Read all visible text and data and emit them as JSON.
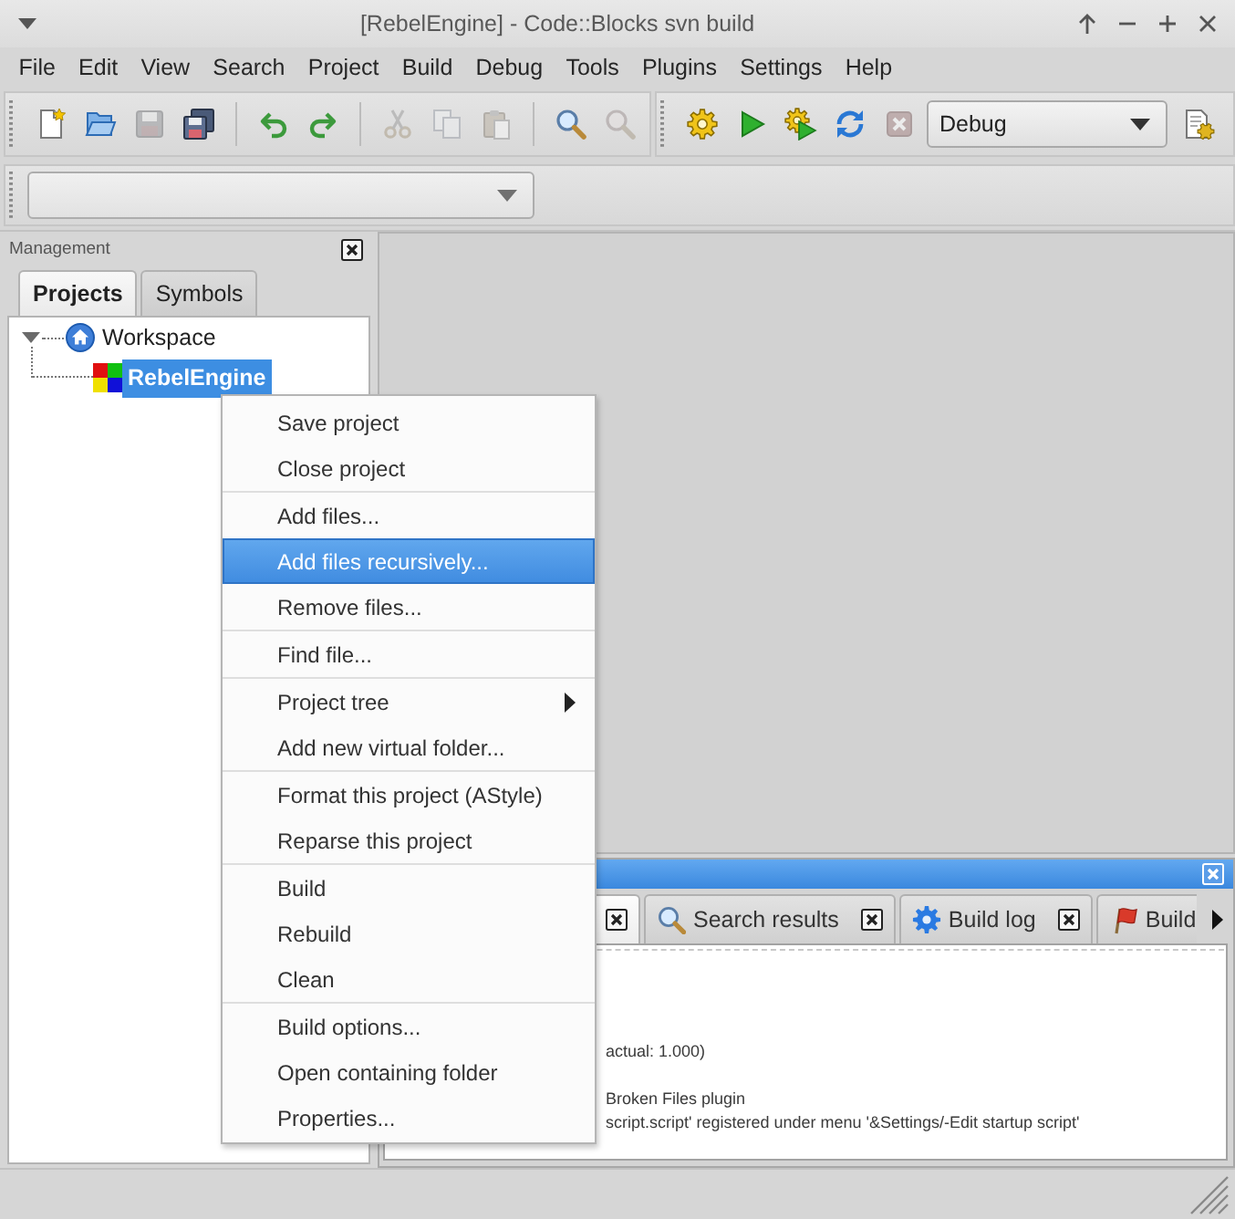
{
  "window": {
    "title": "[RebelEngine] - Code::Blocks svn build"
  },
  "menu_bar": [
    "File",
    "Edit",
    "View",
    "Search",
    "Project",
    "Build",
    "Debug",
    "Tools",
    "Plugins",
    "Settings",
    "Help"
  ],
  "main_toolbar": {
    "buttons": [
      {
        "disabled": false
      },
      {
        "disabled": false
      },
      {
        "disabled": true
      },
      {
        "disabled": false
      },
      {
        "disabled": false
      },
      {
        "disabled": false
      },
      {
        "disabled": true
      },
      {
        "disabled": true
      },
      {
        "disabled": true
      },
      {
        "disabled": false
      },
      {
        "disabled": true
      }
    ]
  },
  "compiler_toolbar": {
    "buttons": [
      {
        "disabled": false
      },
      {
        "disabled": false
      },
      {
        "disabled": false
      },
      {
        "disabled": false
      },
      {
        "disabled": true
      }
    ],
    "build_target": "Debug"
  },
  "management": {
    "title": "Management",
    "tabs": [
      {
        "label": "Projects",
        "selected": true
      },
      {
        "label": "Symbols",
        "selected": false
      }
    ],
    "tree": [
      {
        "label": "Workspace",
        "expanded": true,
        "selected": false,
        "children": [
          {
            "label": "RebelEngine",
            "selected": true
          }
        ]
      }
    ]
  },
  "logs_panel": {
    "tabs": [
      {
        "selected": true
      },
      {
        "label": "Search results",
        "selected": false
      },
      {
        "label": "Build log",
        "selected": false
      },
      {
        "label": "Build",
        "selected": false
      }
    ],
    "lines": [
      "actual: 1.000)",
      "Broken Files plugin",
      "script.script' registered under menu '&Settings/-Edit startup script'"
    ]
  },
  "context_menu": {
    "groups": [
      [
        {
          "label": "Save project",
          "selected": false,
          "submenu": false
        },
        {
          "label": "Close project",
          "selected": false,
          "submenu": false
        }
      ],
      [
        {
          "label": "Add files...",
          "selected": false,
          "submenu": false
        },
        {
          "label": "Add files recursively...",
          "selected": true,
          "submenu": false
        },
        {
          "label": "Remove files...",
          "selected": false,
          "submenu": false
        }
      ],
      [
        {
          "label": "Find file...",
          "selected": false,
          "submenu": false
        }
      ],
      [
        {
          "label": "Project tree",
          "selected": false,
          "submenu": true
        },
        {
          "label": "Add new virtual folder...",
          "selected": false,
          "submenu": false
        }
      ],
      [
        {
          "label": "Format this project (AStyle)",
          "selected": false,
          "submenu": false
        },
        {
          "label": "Reparse this project",
          "selected": false,
          "submenu": false
        }
      ],
      [
        {
          "label": "Build",
          "selected": false,
          "submenu": false
        },
        {
          "label": "Rebuild",
          "selected": false,
          "submenu": false
        },
        {
          "label": "Clean",
          "selected": false,
          "submenu": false
        }
      ],
      [
        {
          "label": "Build options...",
          "selected": false,
          "submenu": false
        },
        {
          "label": "Open containing folder",
          "selected": false,
          "submenu": false
        },
        {
          "label": "Properties...",
          "selected": false,
          "submenu": false
        }
      ]
    ]
  }
}
